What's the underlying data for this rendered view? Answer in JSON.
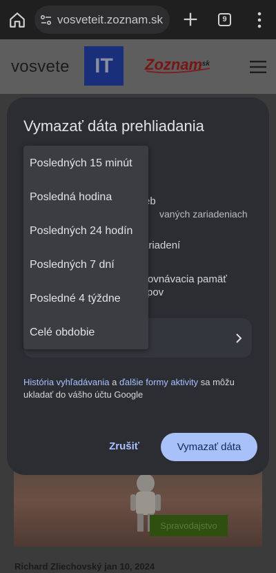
{
  "browser": {
    "url": "vosveteit.zoznam.sk",
    "tab_count": "9"
  },
  "site": {
    "logo_text": "vosvete",
    "logo_badge": "IT",
    "partner_logo": "Zoznam",
    "partner_logo_suffix": ".sk"
  },
  "article": {
    "category": "Spravodajstvo",
    "author": "Richard Zliechovský",
    "date": "jan 10, 2024"
  },
  "dialog": {
    "title": "Vymazať dáta prehliadania",
    "partial_lines": [
      "eb",
      "vaných zariadeniach",
      "ariadení",
      "rovnávacia pamäť",
      "pov"
    ],
    "info_link_1": "História vyhľadávania",
    "info_and": " a ",
    "info_link_2": "ďalšie formy aktivity",
    "info_rest": " sa môžu ukladať do vášho účtu Google",
    "cancel_label": "Zrušiť",
    "confirm_label": "Vymazať dáta"
  },
  "time_range_menu": {
    "items": [
      "Posledných 15 minút",
      "Posledná hodina",
      "Posledných 24 hodín",
      "Posledných 7 dní",
      "Posledné 4 týždne",
      "Celé obdobie"
    ]
  },
  "colors": {
    "dialog_bg": "#2b2d33",
    "accent": "#a8c2ff",
    "confirm_button": "#a9c1f9",
    "toolbar_bg": "#1f1f1f"
  },
  "icons": {
    "home": "home-icon",
    "site_info": "tune-icon",
    "new_tab": "plus-icon",
    "menu": "more-vert-icon",
    "hamburger": "hamburger-icon",
    "range_chevron": "chevron-right-icon"
  }
}
